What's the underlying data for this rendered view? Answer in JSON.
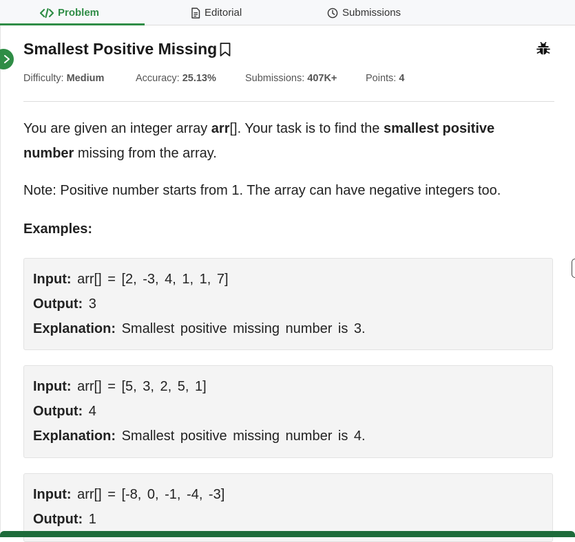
{
  "tabs": [
    {
      "label": "Problem",
      "icon": "code-icon",
      "active": true
    },
    {
      "label": "Editorial",
      "icon": "document-icon",
      "active": false
    },
    {
      "label": "Submissions",
      "icon": "clock-icon",
      "active": false
    }
  ],
  "problem": {
    "title": "Smallest Positive Missing",
    "meta": {
      "difficulty_label": "Difficulty:",
      "difficulty": "Medium",
      "accuracy_label": "Accuracy:",
      "accuracy": "25.13%",
      "submissions_label": "Submissions:",
      "submissions": "407K+",
      "points_label": "Points:",
      "points": "4"
    },
    "desc": {
      "t1": "You are given an integer array ",
      "b1": "arr",
      "t2": "[]. Your task is to find the ",
      "b2": "smallest positive number",
      "t3": " missing from the array."
    },
    "note": "Note: Positive number starts from 1. The array can have negative integers too.",
    "examples_heading": "Examples:",
    "examples": [
      {
        "input_label": "Input:",
        "input": "arr[] = [2, -3, 4, 1, 1, 7]",
        "output_label": "Output:",
        "output": "3",
        "explanation_label": "Explanation:",
        "explanation": "Smallest positive missing number is 3."
      },
      {
        "input_label": "Input:",
        "input": "arr[] = [5, 3, 2, 5, 1]",
        "output_label": "Output:",
        "output": "4",
        "explanation_label": "Explanation:",
        "explanation": "Smallest positive missing number is 4."
      },
      {
        "input_label": "Input:",
        "input": "arr[] = [-8, 0, -1, -4, -3]",
        "output_label": "Output:",
        "output": "1"
      }
    ]
  },
  "colors": {
    "accent": "#2f8d46",
    "footer": "#1e6b3a"
  }
}
